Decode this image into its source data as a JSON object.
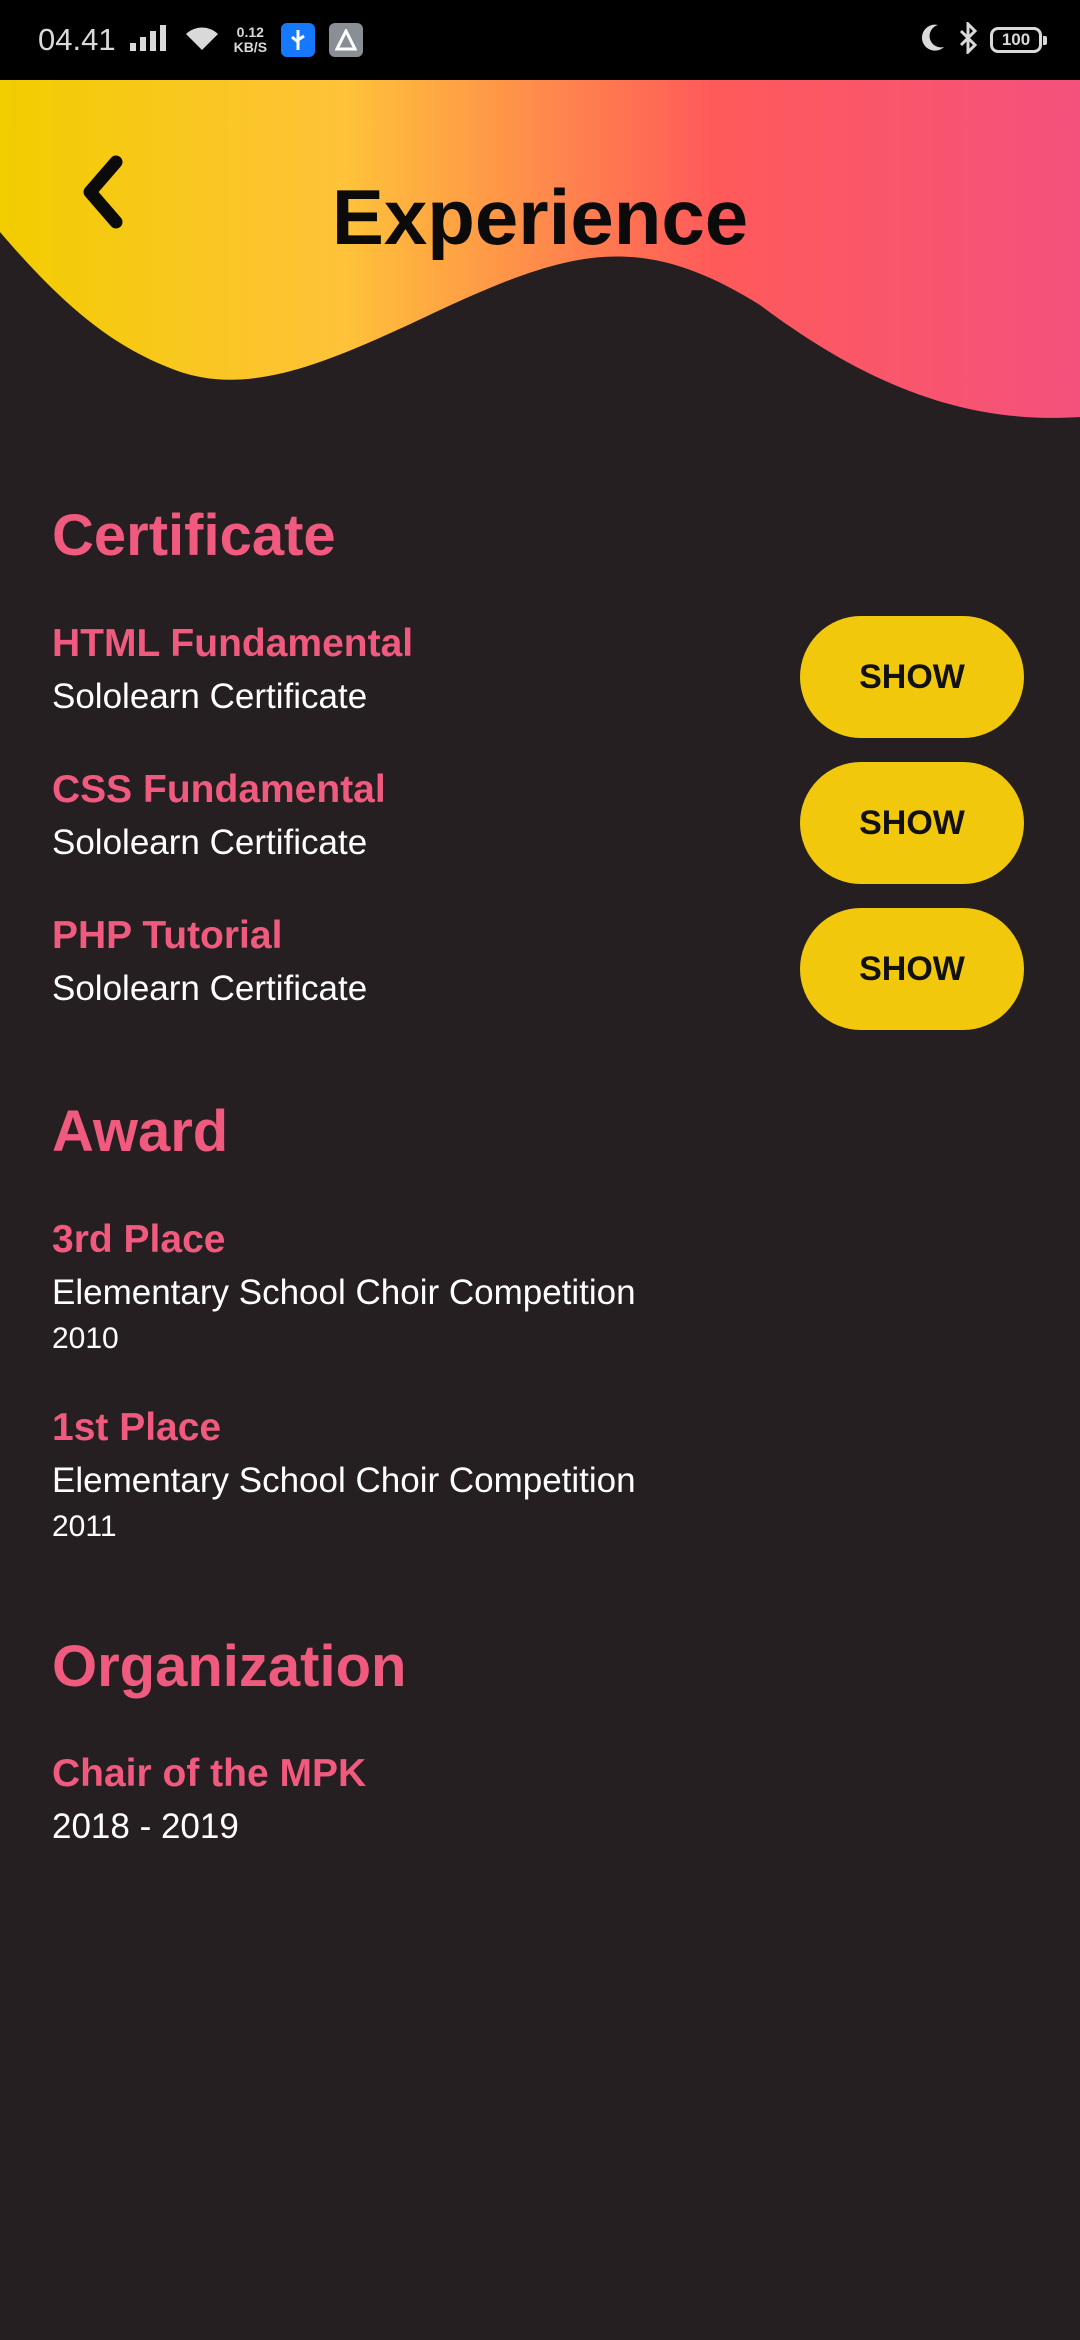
{
  "status_bar": {
    "time": "04.41",
    "net_speed_value": "0.12",
    "net_speed_unit": "KB/S",
    "battery": "100"
  },
  "header": {
    "title": "Experience",
    "gradient": [
      "#f2cd00",
      "#ffc23a",
      "#ff5a5a",
      "#f4517e"
    ]
  },
  "certificate": {
    "title": "Certificate",
    "items": [
      {
        "name": "HTML Fundamental",
        "issuer": "Sololearn Certificate",
        "button": "SHOW"
      },
      {
        "name": "CSS Fundamental",
        "issuer": "Sololearn Certificate",
        "button": "SHOW"
      },
      {
        "name": "PHP Tutorial",
        "issuer": "Sololearn Certificate",
        "button": "SHOW"
      }
    ]
  },
  "award": {
    "title": "Award",
    "items": [
      {
        "place": "3rd Place",
        "event": "Elementary School Choir Competition",
        "year": "2010"
      },
      {
        "place": "1st Place",
        "event": "Elementary School Choir Competition",
        "year": "2011"
      }
    ]
  },
  "organization": {
    "title": "Organization",
    "items": [
      {
        "role": "Chair of the MPK",
        "period": "2018 - 2019"
      }
    ]
  },
  "colors": {
    "accent_pink": "#f05a7e",
    "button_yellow": "#f2c80c",
    "background": "#261f21"
  }
}
